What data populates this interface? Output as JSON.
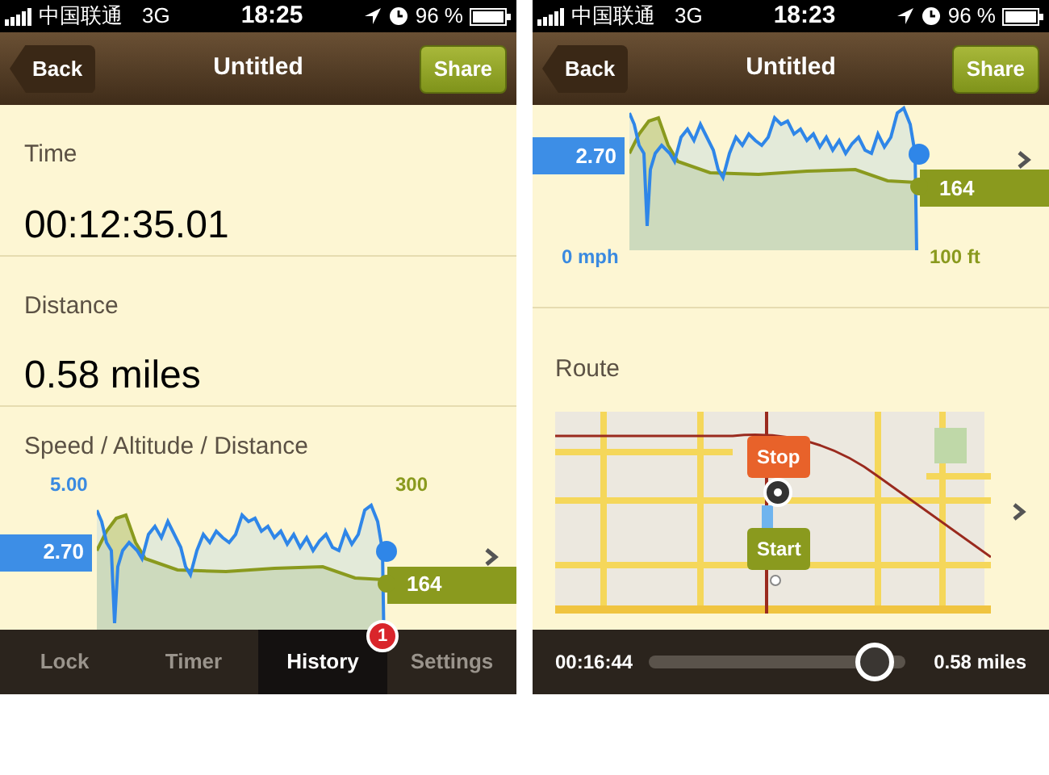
{
  "screens": [
    {
      "status_bar": {
        "carrier": "中国联通",
        "network": "3G",
        "time": "18:25",
        "battery": "96 %"
      },
      "nav_bar": {
        "back": "Back",
        "title": "Untitled",
        "share": "Share"
      },
      "stats": [
        {
          "label": "Time",
          "value": "00:12:35.01"
        },
        {
          "label": "Distance",
          "value": "0.58 miles"
        }
      ],
      "chart": {
        "title": "Speed / Altitude / Distance",
        "speed_max": "5.00",
        "altitude_max": "300",
        "speed_reading": "2.70",
        "altitude_reading": "164"
      },
      "tab_bar": [
        {
          "label": "Lock",
          "selected": false
        },
        {
          "label": "Timer",
          "selected": false
        },
        {
          "label": "History",
          "selected": true,
          "badge": "1"
        },
        {
          "label": "Settings",
          "selected": false
        }
      ]
    },
    {
      "status_bar": {
        "carrier": "中国联通",
        "network": "3G",
        "time": "18:23",
        "battery": "96 %"
      },
      "nav_bar": {
        "back": "Back",
        "title": "Untitled",
        "share": "Share"
      },
      "chart": {
        "speed_reading": "2.70",
        "altitude_reading": "164",
        "speed_min": "0 mph",
        "altitude_min": "100 ft"
      },
      "route": {
        "title": "Route",
        "pins": [
          {
            "kind": "stop",
            "label": "Stop"
          },
          {
            "kind": "start",
            "label": "Start"
          }
        ]
      },
      "playback_bar": {
        "elapsed": "00:16:44",
        "level": 0.95,
        "distance": "0.58 miles"
      }
    }
  ]
}
